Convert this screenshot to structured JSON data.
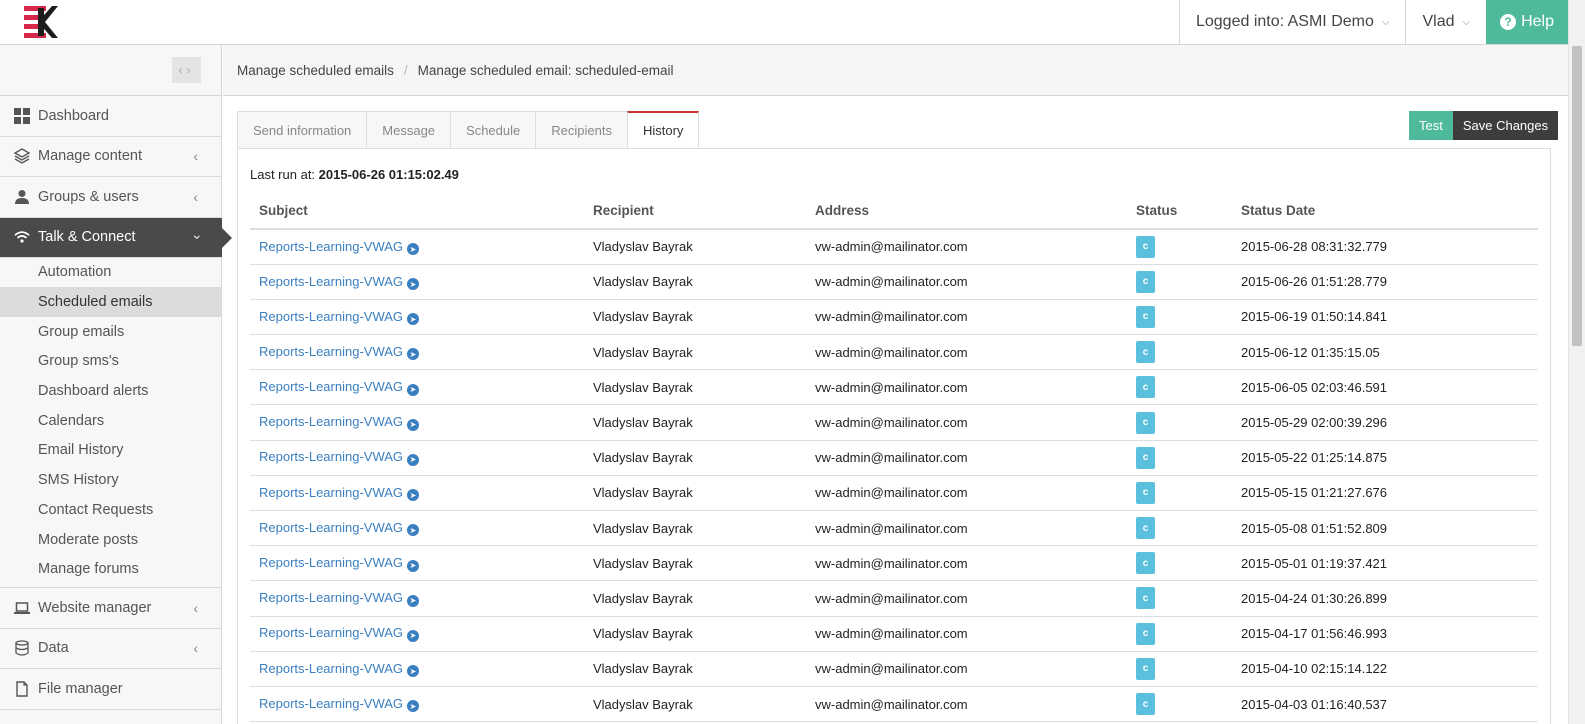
{
  "topbar": {
    "logged_into": "Logged into: ASMI Demo",
    "user": "Vlad",
    "help": "Help"
  },
  "colors": {
    "accent": "#4fba9b",
    "active_nav": "#4a4a4a",
    "link": "#3a7fc0",
    "status": "#5bc0de",
    "tab_active_border": "#cc3333"
  },
  "sidebar": {
    "items": [
      {
        "label": "Dashboard",
        "icon": "grid-icon"
      },
      {
        "label": "Manage content",
        "icon": "layers-icon"
      },
      {
        "label": "Groups & users",
        "icon": "user-icon"
      },
      {
        "label": "Talk & Connect",
        "icon": "wifi-icon"
      }
    ],
    "sub_items": [
      "Automation",
      "Scheduled emails",
      "Group emails",
      "Group sms's",
      "Dashboard alerts",
      "Calendars",
      "Email History",
      "SMS History",
      "Contact Requests",
      "Moderate posts",
      "Manage forums"
    ],
    "bottom_items": [
      {
        "label": "Website manager",
        "icon": "laptop-icon"
      },
      {
        "label": "Data",
        "icon": "database-icon"
      },
      {
        "label": "File manager",
        "icon": "file-icon"
      }
    ]
  },
  "breadcrumb": {
    "items": [
      "Manage scheduled emails",
      "Manage scheduled email: scheduled-email"
    ],
    "separator": "/"
  },
  "tabs": [
    "Send information",
    "Message",
    "Schedule",
    "Recipients",
    "History"
  ],
  "buttons": {
    "test": "Test",
    "save": "Save Changes"
  },
  "history": {
    "last_run_label": "Last run at:",
    "last_run_value": "2015-06-26 01:15:02.49",
    "columns": [
      "Subject",
      "Recipient",
      "Address",
      "Status",
      "Status Date"
    ],
    "rows": [
      {
        "subject": "Reports-Learning-VWAG",
        "recipient": "Vladyslav Bayrak",
        "address": "vw-admin@mailinator.com",
        "status": "c",
        "date": "2015-06-28 08:31:32.779"
      },
      {
        "subject": "Reports-Learning-VWAG",
        "recipient": "Vladyslav Bayrak",
        "address": "vw-admin@mailinator.com",
        "status": "c",
        "date": "2015-06-26 01:51:28.779"
      },
      {
        "subject": "Reports-Learning-VWAG",
        "recipient": "Vladyslav Bayrak",
        "address": "vw-admin@mailinator.com",
        "status": "c",
        "date": "2015-06-19 01:50:14.841"
      },
      {
        "subject": "Reports-Learning-VWAG",
        "recipient": "Vladyslav Bayrak",
        "address": "vw-admin@mailinator.com",
        "status": "c",
        "date": "2015-06-12 01:35:15.05"
      },
      {
        "subject": "Reports-Learning-VWAG",
        "recipient": "Vladyslav Bayrak",
        "address": "vw-admin@mailinator.com",
        "status": "c",
        "date": "2015-06-05 02:03:46.591"
      },
      {
        "subject": "Reports-Learning-VWAG",
        "recipient": "Vladyslav Bayrak",
        "address": "vw-admin@mailinator.com",
        "status": "c",
        "date": "2015-05-29 02:00:39.296"
      },
      {
        "subject": "Reports-Learning-VWAG",
        "recipient": "Vladyslav Bayrak",
        "address": "vw-admin@mailinator.com",
        "status": "c",
        "date": "2015-05-22 01:25:14.875"
      },
      {
        "subject": "Reports-Learning-VWAG",
        "recipient": "Vladyslav Bayrak",
        "address": "vw-admin@mailinator.com",
        "status": "c",
        "date": "2015-05-15 01:21:27.676"
      },
      {
        "subject": "Reports-Learning-VWAG",
        "recipient": "Vladyslav Bayrak",
        "address": "vw-admin@mailinator.com",
        "status": "c",
        "date": "2015-05-08 01:51:52.809"
      },
      {
        "subject": "Reports-Learning-VWAG",
        "recipient": "Vladyslav Bayrak",
        "address": "vw-admin@mailinator.com",
        "status": "c",
        "date": "2015-05-01 01:19:37.421"
      },
      {
        "subject": "Reports-Learning-VWAG",
        "recipient": "Vladyslav Bayrak",
        "address": "vw-admin@mailinator.com",
        "status": "c",
        "date": "2015-04-24 01:30:26.899"
      },
      {
        "subject": "Reports-Learning-VWAG",
        "recipient": "Vladyslav Bayrak",
        "address": "vw-admin@mailinator.com",
        "status": "c",
        "date": "2015-04-17 01:56:46.993"
      },
      {
        "subject": "Reports-Learning-VWAG",
        "recipient": "Vladyslav Bayrak",
        "address": "vw-admin@mailinator.com",
        "status": "c",
        "date": "2015-04-10 02:15:14.122"
      },
      {
        "subject": "Reports-Learning-VWAG",
        "recipient": "Vladyslav Bayrak",
        "address": "vw-admin@mailinator.com",
        "status": "c",
        "date": "2015-04-03 01:16:40.537"
      }
    ]
  }
}
